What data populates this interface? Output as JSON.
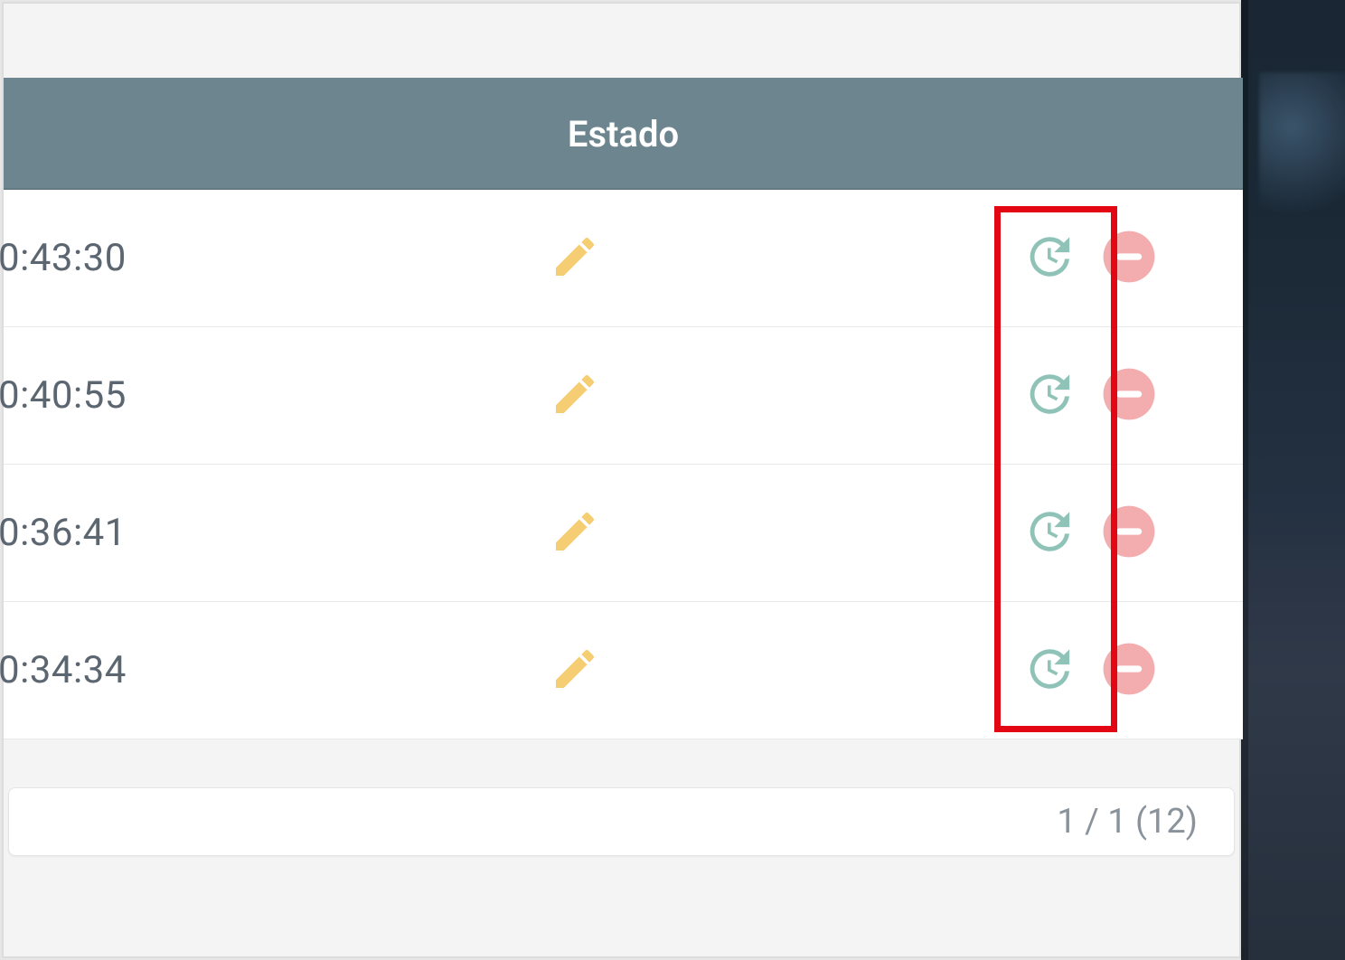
{
  "colors": {
    "header_bg": "#6d858f",
    "pencil": "#f5cd73",
    "history": "#8fc3b8",
    "delete": "#f3adae",
    "delete_dash": "#ffffff",
    "highlight_border": "#e30613",
    "text_muted": "#5b6670",
    "pagination_text": "#8a939b"
  },
  "table": {
    "columns": {
      "estado": "Estado"
    },
    "rows": [
      {
        "time": "0:43:30"
      },
      {
        "time": "0:40:55"
      },
      {
        "time": "0:36:41"
      },
      {
        "time": "0:34:34"
      }
    ]
  },
  "pagination": {
    "text": "1 / 1 (12)"
  }
}
